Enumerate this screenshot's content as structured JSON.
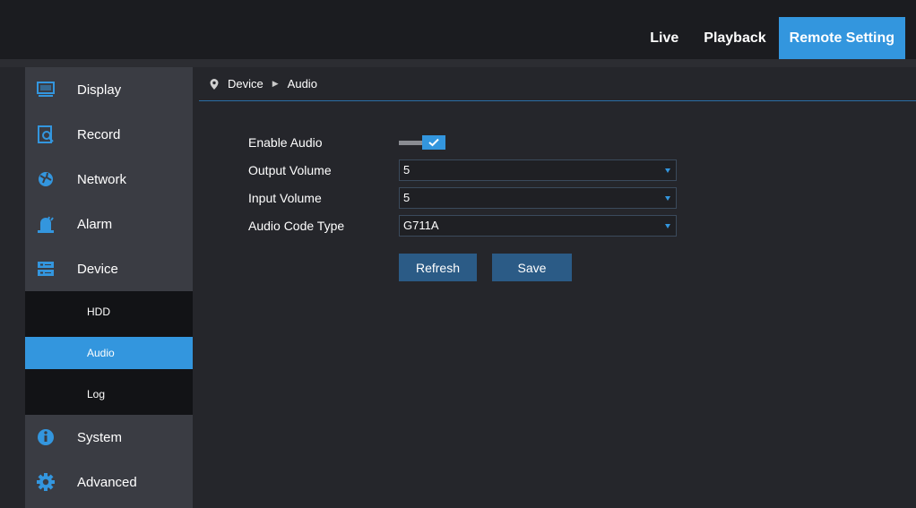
{
  "topnav": {
    "items": [
      {
        "label": "Live",
        "active": false
      },
      {
        "label": "Playback",
        "active": false
      },
      {
        "label": "Remote Setting",
        "active": true
      }
    ]
  },
  "sidebar": {
    "items": [
      {
        "label": "Display",
        "icon": "monitor-icon"
      },
      {
        "label": "Record",
        "icon": "record-search-icon"
      },
      {
        "label": "Network",
        "icon": "network-globe-icon"
      },
      {
        "label": "Alarm",
        "icon": "alarm-siren-icon"
      },
      {
        "label": "Device",
        "icon": "device-storage-icon"
      },
      {
        "label": "System",
        "icon": "info-icon"
      },
      {
        "label": "Advanced",
        "icon": "gear-icon"
      }
    ],
    "device_subitems": [
      {
        "label": "HDD",
        "active": false
      },
      {
        "label": "Audio",
        "active": true
      },
      {
        "label": "Log",
        "active": false
      }
    ]
  },
  "breadcrumb": {
    "section": "Device",
    "page": "Audio"
  },
  "form": {
    "enable_audio": {
      "label": "Enable Audio",
      "checked": true
    },
    "output_volume": {
      "label": "Output Volume",
      "value": "5"
    },
    "input_volume": {
      "label": "Input Volume",
      "value": "5"
    },
    "audio_code_type": {
      "label": "Audio Code Type",
      "value": "G711A"
    }
  },
  "buttons": {
    "refresh": "Refresh",
    "save": "Save"
  },
  "colors": {
    "accent": "#3396de",
    "button": "#2b5b86",
    "sidebar": "#3a3c43",
    "background": "#25262b"
  }
}
